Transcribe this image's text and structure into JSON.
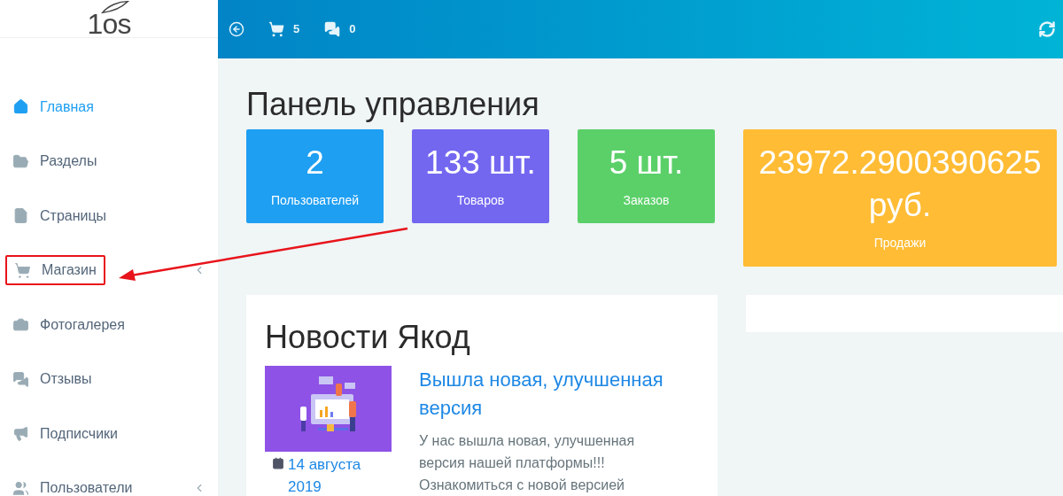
{
  "logo": {
    "text": "1os"
  },
  "sidebar": {
    "items": [
      {
        "label": "Главная",
        "selected": true,
        "expandable": false,
        "highlighted": false
      },
      {
        "label": "Разделы",
        "selected": false,
        "expandable": false,
        "highlighted": false
      },
      {
        "label": "Страницы",
        "selected": false,
        "expandable": false,
        "highlighted": false
      },
      {
        "label": "Магазин",
        "selected": false,
        "expandable": true,
        "highlighted": true
      },
      {
        "label": "Фотогалерея",
        "selected": false,
        "expandable": false,
        "highlighted": false
      },
      {
        "label": "Отзывы",
        "selected": false,
        "expandable": false,
        "highlighted": false
      },
      {
        "label": "Подписчики",
        "selected": false,
        "expandable": false,
        "highlighted": false
      },
      {
        "label": "Пользователи",
        "selected": false,
        "expandable": true,
        "highlighted": false
      }
    ]
  },
  "topbar": {
    "cart_count": "5",
    "messages_count": "0"
  },
  "page_title": "Панель управления",
  "stats": [
    {
      "value": "2",
      "label": "Пользователей",
      "color": "#1e9ff2"
    },
    {
      "value": "133 шт.",
      "label": "Товаров",
      "color": "#7367f0"
    },
    {
      "value": "5 шт.",
      "label": "Заказов",
      "color": "#5bd069"
    },
    {
      "value": "23972.2900390625 руб.",
      "label": "Продажи",
      "color": "#ffbc34"
    }
  ],
  "news": {
    "title": "Новости Якод",
    "items": [
      {
        "kind": "picture",
        "date": "14 августа 2019",
        "headline": "Вышла новая, улучшенная версия",
        "text": "У нас вышла новая, улучшенная версия нашей платформы!!! Ознакомиться с новой версией"
      }
    ]
  }
}
